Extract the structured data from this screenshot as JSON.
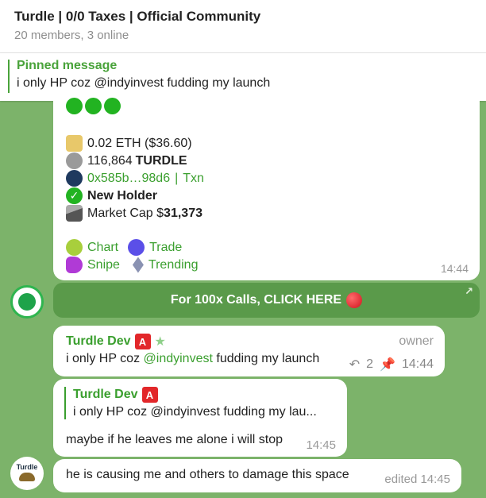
{
  "header": {
    "title": "Turdle | 0/0 Taxes | Official Community",
    "subtitle": "20 members, 3 online"
  },
  "pinned": {
    "label": "Pinned message",
    "text": "i only HP coz @indyinvest fudding my launch"
  },
  "bot_message": {
    "eth": "0.02 ETH ($36.60)",
    "amount_value": "116,864",
    "amount_token": "TURDLE",
    "address": "0x585b…98d6",
    "sep": "|",
    "txn": "Txn",
    "holder_label": "New Holder",
    "mcap_label": "Market Cap $",
    "mcap_value": "31,373",
    "link_chart": "Chart",
    "link_trade": "Trade",
    "link_snipe": "Snipe",
    "link_trending": "Trending",
    "time": "14:44"
  },
  "cta": {
    "label": "For 100x Calls, CLICK HERE"
  },
  "messages": [
    {
      "author": "Turdle Dev",
      "role": "owner",
      "text_prefix": "i only HP coz ",
      "mention": "@indyinvest",
      "text_suffix": " fudding my launch",
      "replies": "2",
      "time": "14:44"
    },
    {
      "quote_author": "Turdle Dev",
      "quote_text": "i only HP coz @indyinvest fudding my lau...",
      "text": "maybe if he leaves me alone i will stop",
      "time": "14:45"
    },
    {
      "text": "he is causing me and others to damage this space",
      "time": "edited 14:45"
    }
  ],
  "avatars": {
    "turdle_label": "Turdle"
  }
}
